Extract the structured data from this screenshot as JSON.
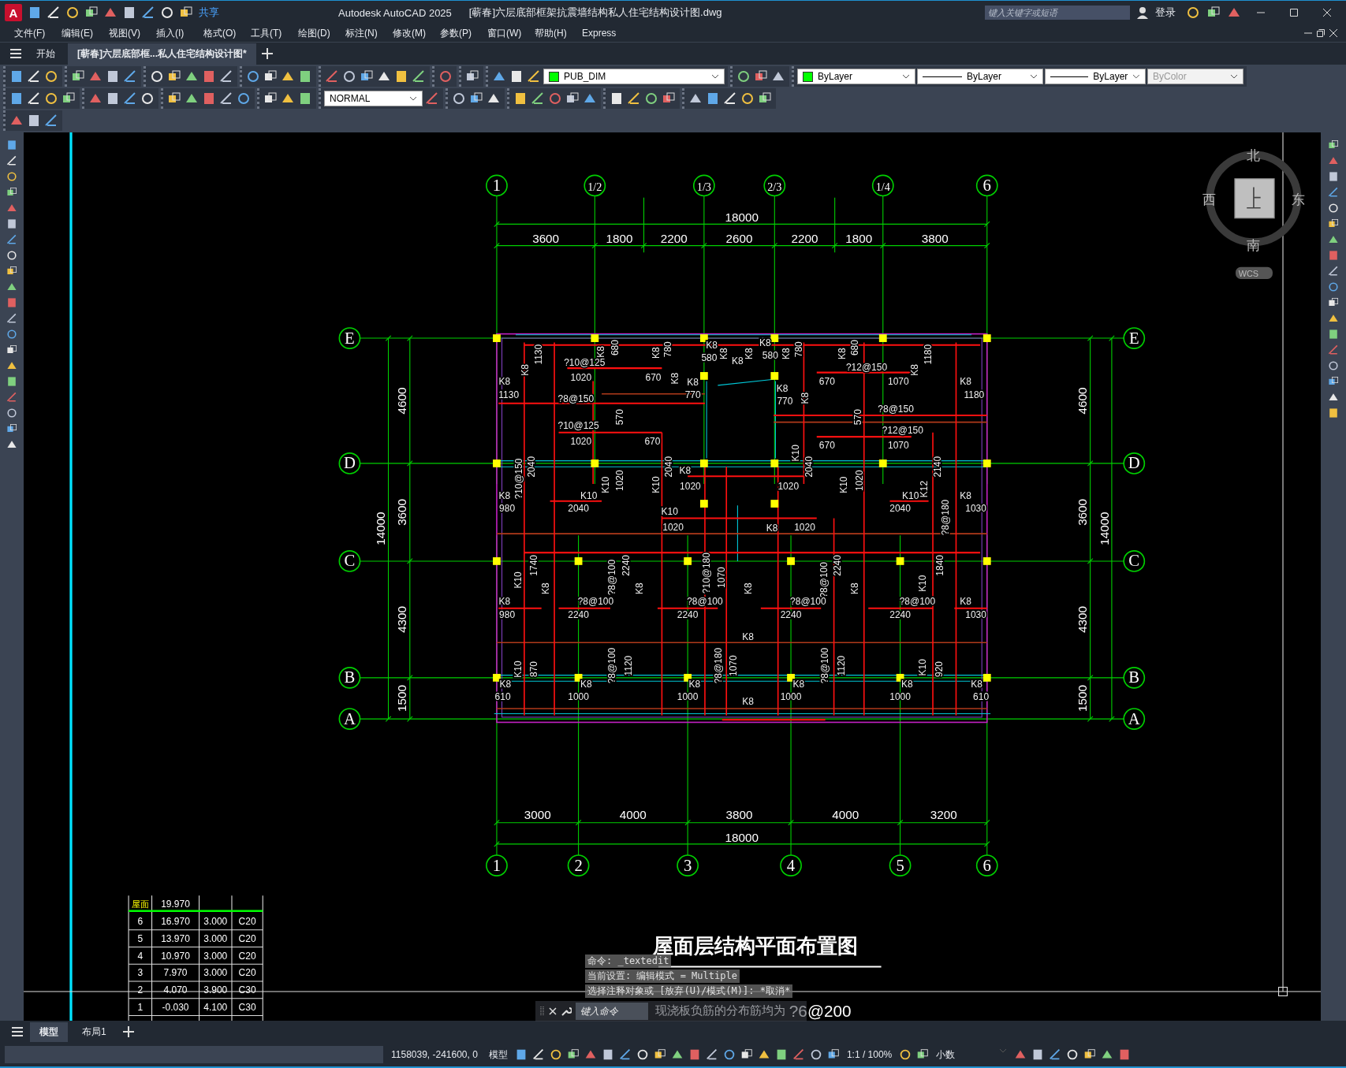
{
  "title_bar": {
    "logo": "A",
    "share": "共享",
    "app": "Autodesk AutoCAD 2025",
    "file": "[蕲春]六层底部框架抗震墙结构私人住宅结构设计图.dwg",
    "search": {
      "placeholder": "键入关键字或短语"
    },
    "sign_in": "登录"
  },
  "menu": [
    "文件(F)",
    "编辑(E)",
    "视图(V)",
    "插入(I)",
    "格式(O)",
    "工具(T)",
    "绘图(D)",
    "标注(N)",
    "修改(M)",
    "参数(P)",
    "窗口(W)",
    "帮助(H)",
    "Express"
  ],
  "doc_tabs": [
    {
      "label": "开始",
      "selected": false
    },
    {
      "label": "[蕲春]六层底部框...私人住宅结构设计图*",
      "selected": true
    }
  ],
  "toolbar": {
    "layer": "PUB_DIM",
    "color_property": "ByLayer",
    "linetype": "ByLayer",
    "lineweight": "ByLayer",
    "plot_style": {
      "label": "ByColor",
      "disabled": true
    },
    "text_style": "NORMAL"
  },
  "drawing": {
    "top_axes": [
      "1",
      "1/2",
      "1/3",
      "2/3",
      "1/4",
      "6"
    ],
    "bottom_axes": [
      "1",
      "2",
      "3",
      "4",
      "5",
      "6"
    ],
    "left_axes": [
      "E",
      "D",
      "C",
      "B",
      "A"
    ],
    "right_axes": [
      "E",
      "D",
      "C",
      "B",
      "A"
    ],
    "top_dims": {
      "total": "18000",
      "parts": [
        "3600",
        "1800",
        "2200",
        "2600",
        "2200",
        "1800",
        "3800"
      ]
    },
    "bottom_dims": {
      "total": "18000",
      "parts": [
        "3000",
        "4000",
        "3800",
        "4000",
        "3200"
      ]
    },
    "left_dims": {
      "total": "14000",
      "parts": [
        "4600",
        "3600",
        "4300",
        "1500"
      ]
    },
    "right_dims": {
      "total": "14000",
      "parts": [
        "4600",
        "3600",
        "4300",
        "1500"
      ]
    },
    "plan_labels": [
      "K8",
      "1130",
      "?10@125",
      "K8",
      "680",
      "K8",
      "780",
      "K8",
      "580",
      "K8",
      "K8",
      "K8",
      "K8",
      "580",
      "K8",
      "780",
      "K8",
      "680",
      "?12@150",
      "K8",
      "1180",
      "K8",
      "1020",
      "670",
      "K8",
      "K8",
      "670",
      "1070",
      "K8",
      "1130",
      "?8@150",
      "770",
      "K8",
      "770",
      "K8",
      "1180",
      "570",
      "570",
      "?8@150",
      "?10@125",
      "?12@150",
      "1020",
      "670",
      "K10",
      "670",
      "1070",
      "?10@150",
      "2040",
      "K10",
      "1020",
      "K10",
      "2040",
      "K8",
      "1020",
      "1020",
      "2040",
      "K10",
      "1020",
      "K12",
      "2140",
      "K8",
      "K10",
      "K10",
      "K8",
      "980",
      "2040",
      "K10",
      "2040",
      "?8@180",
      "1030",
      "1020",
      "K8",
      "1020",
      "K10",
      "1740",
      "K8",
      "?8@100",
      "2240",
      "K8",
      "?10@180",
      "1070",
      "K8",
      "?8@100",
      "2240",
      "K8",
      "K10",
      "1840",
      "K8",
      "?8@100",
      "?8@100",
      "?8@100",
      "?8@100",
      "K8",
      "980",
      "2240",
      "2240",
      "2240",
      "2240",
      "1030",
      "K8",
      "K10",
      "870",
      "?8@100",
      "1120",
      "?8@180",
      "1070",
      "?8@100",
      "1120",
      "K10",
      "920",
      "K8",
      "K8",
      "K8",
      "K8",
      "K8",
      "K8",
      "610",
      "1000",
      "1000",
      "K8",
      "1000",
      "1000",
      "610"
    ],
    "title": "屋面层结构平面布置图",
    "note": "现浇板负筋的分布筋均为",
    "note_spec": "?6@200",
    "floor_table": [
      [
        "屋面",
        "19.970"
      ],
      [
        "6",
        "16.970",
        "3.000",
        "C20"
      ],
      [
        "5",
        "13.970",
        "3.000",
        "C20"
      ],
      [
        "4",
        "10.970",
        "3.000",
        "C20"
      ],
      [
        "3",
        "7.970",
        "3.000",
        "C20"
      ],
      [
        "2",
        "4.070",
        "3.900",
        "C30"
      ],
      [
        "1",
        "-0.030",
        "4.100",
        "C30"
      ]
    ]
  },
  "compass": {
    "north": "北",
    "south": "南",
    "east": "东",
    "west": "西",
    "ucs": "WCS"
  },
  "command": {
    "history": [
      "命令:  _textedit",
      "当前设置: 编辑模式 = Multiple",
      "选择注释对象或 [放弃(U)/模式(M)]: *取消*"
    ],
    "placeholder": "键入命令"
  },
  "layout_tabs": [
    {
      "label": "模型",
      "selected": true
    },
    {
      "label": "布局1",
      "selected": false
    }
  ],
  "status_bar": {
    "coordinates": "1158039, -241600, 0",
    "space": "模型",
    "scale": "1:1 / 100%",
    "units": "小数"
  }
}
